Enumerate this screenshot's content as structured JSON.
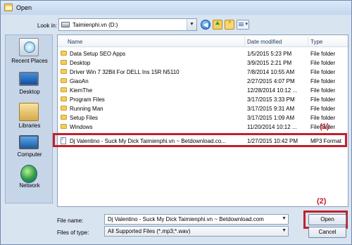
{
  "window": {
    "title": "Open"
  },
  "toolbar": {
    "look_in_label": "Look in:",
    "look_in_value": "Taimienphi.vn (D:)",
    "icons": [
      "back-arrow-icon",
      "up-folder-icon",
      "new-folder-icon",
      "view-menu-icon"
    ]
  },
  "places": [
    {
      "label": "Recent Places",
      "icon": "recent-places-icon"
    },
    {
      "label": "Desktop",
      "icon": "desktop-icon"
    },
    {
      "label": "Libraries",
      "icon": "libraries-icon"
    },
    {
      "label": "Computer",
      "icon": "computer-icon"
    },
    {
      "label": "Network",
      "icon": "network-icon"
    }
  ],
  "file_list": {
    "columns": {
      "name": "Name",
      "date": "Date modified",
      "type": "Type"
    },
    "rows": [
      {
        "name": "Data Setup SEO Apps",
        "date": "1/5/2015 5:23 PM",
        "type": "File folder",
        "icon": "folder-icon"
      },
      {
        "name": "Desktop",
        "date": "3/9/2015 2:21 PM",
        "type": "File folder",
        "icon": "folder-icon"
      },
      {
        "name": "Driver Win 7 32Bit For DELL Ins 15R N5110",
        "date": "7/8/2014 10:55 AM",
        "type": "File folder",
        "icon": "folder-icon"
      },
      {
        "name": "GiaoAn",
        "date": "2/27/2015 4:07 PM",
        "type": "File folder",
        "icon": "folder-icon"
      },
      {
        "name": "KiemThe",
        "date": "12/28/2014 10:12 ...",
        "type": "File folder",
        "icon": "folder-icon"
      },
      {
        "name": "Program Files",
        "date": "3/17/2015 3:33 PM",
        "type": "File folder",
        "icon": "folder-icon"
      },
      {
        "name": "Running Man",
        "date": "3/17/2015 9:31 AM",
        "type": "File folder",
        "icon": "folder-icon"
      },
      {
        "name": "Setup Files",
        "date": "3/17/2015 1:09 AM",
        "type": "File folder",
        "icon": "folder-icon"
      },
      {
        "name": "Windows",
        "date": "11/20/2014 10:12 ...",
        "type": "File folder",
        "icon": "folder-icon"
      },
      {
        "name": "Dj Valentino - Suck My Dick Taimienphi.vn ~ Betdownload.co...",
        "date": "1/27/2015 10:42 PM",
        "type": "MP3 Format",
        "icon": "audio-file-icon"
      }
    ]
  },
  "annotations": {
    "row_marker": "(1)",
    "button_marker": "(2)",
    "highlight_color": "#c0202c"
  },
  "footer": {
    "file_name_label": "File name:",
    "file_name_value": "Dj Valentino - Suck My Dick Taimienphi.vn ~ Betdownload.com",
    "file_type_label": "Files of type:",
    "file_type_value": "All Supported Files (*.mp3;*.wav)",
    "open_label": "Open",
    "cancel_label": "Cancel"
  }
}
